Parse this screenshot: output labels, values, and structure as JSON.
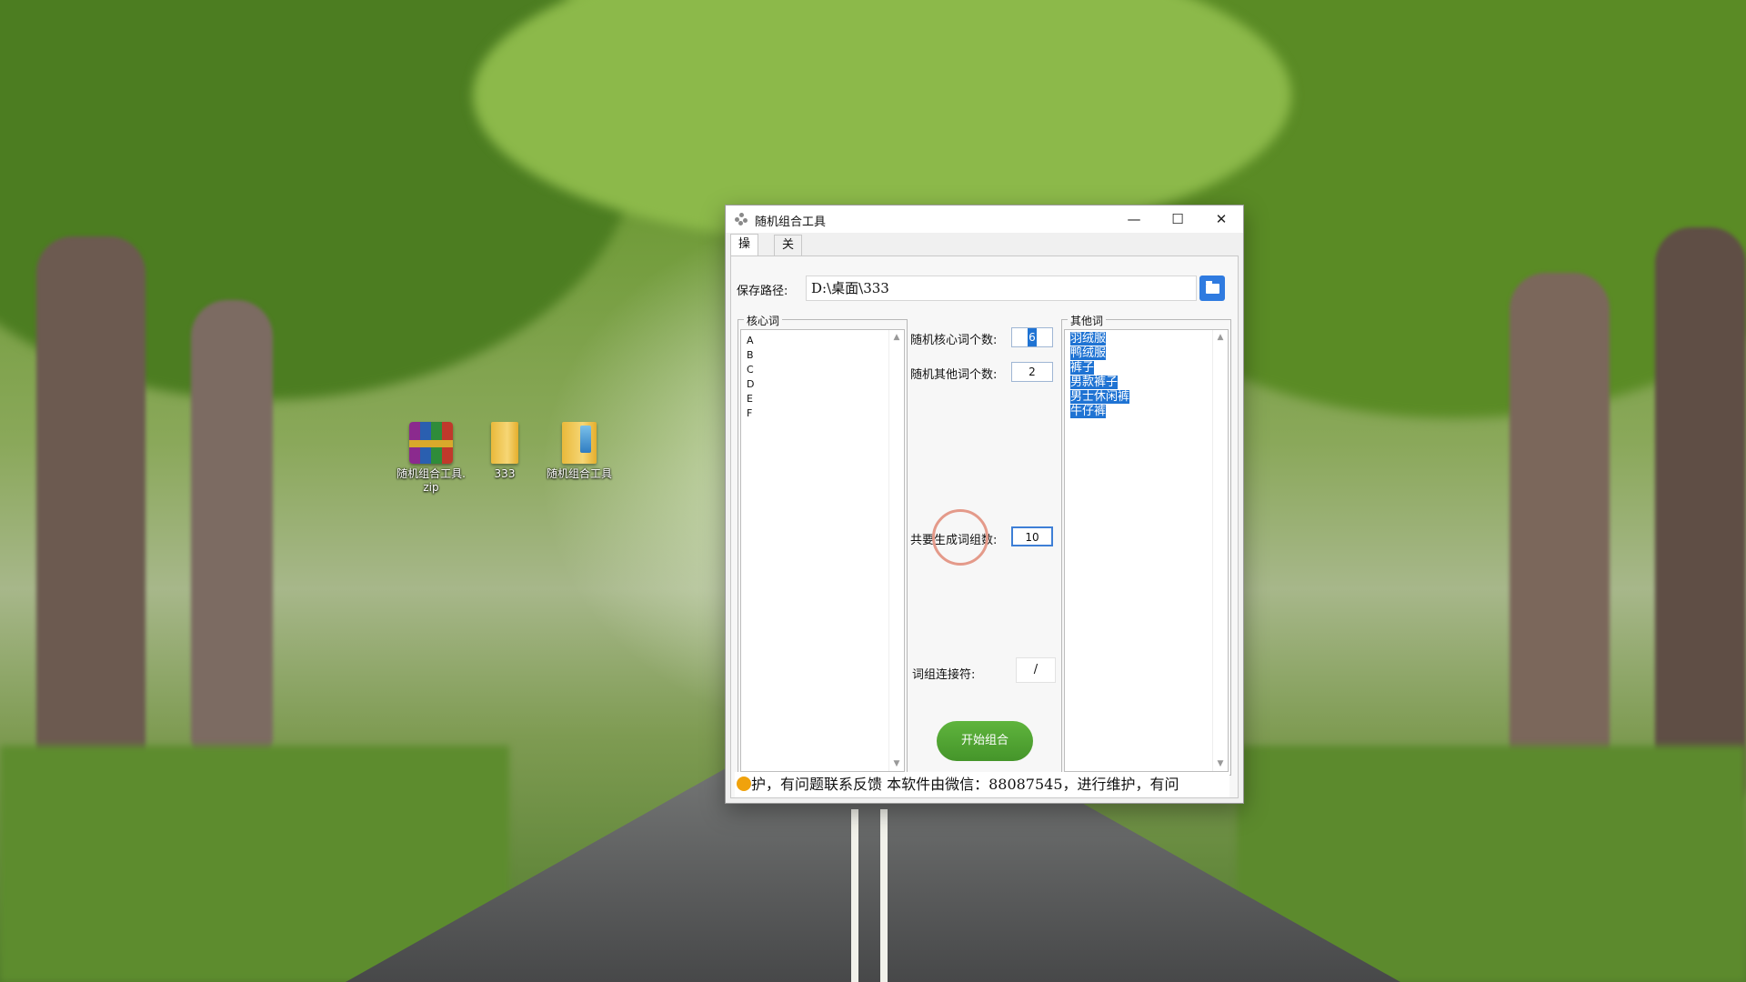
{
  "desktop": {
    "icons": [
      {
        "label": "随机组合工具.zip",
        "type": "archive"
      },
      {
        "label": "333",
        "type": "folder"
      },
      {
        "label": "随机组合工具",
        "type": "folder"
      }
    ]
  },
  "window": {
    "title": "随机组合工具",
    "controls": {
      "minimize": "—",
      "maximize": "☐",
      "close": "✕"
    },
    "tabs": [
      {
        "label": "操作",
        "active": true
      },
      {
        "label": "关于",
        "active": false
      }
    ],
    "save_path": {
      "label": "保存路径:",
      "value": "D:\\桌面\\333"
    },
    "core_words": {
      "title": "核心词",
      "items": [
        "A",
        "B",
        "C",
        "D",
        "E",
        "F"
      ]
    },
    "other_words": {
      "title": "其他词",
      "items": [
        "羽绒服",
        "鸭绒服",
        "裤子",
        "男款裤子",
        "男士休闲裤",
        "牛仔裤"
      ],
      "selected": true
    },
    "settings": {
      "random_core_count": {
        "label": "随机核心词个数:",
        "value": "6"
      },
      "random_other_count": {
        "label": "随机其他词个数:",
        "value": "2"
      },
      "total_groups": {
        "label": "共要生成词组数:",
        "value": "10"
      },
      "connector": {
        "label": "词组连接符:",
        "value": "/"
      }
    },
    "start_button": {
      "label": "开始组合"
    },
    "status_text": "护，有问题联系反馈    本软件由微信：88087545，进行维护，有问"
  },
  "colors": {
    "accent_blue": "#2f7be0",
    "start_green": "#4fa332",
    "selection_blue": "#1f73d3"
  }
}
